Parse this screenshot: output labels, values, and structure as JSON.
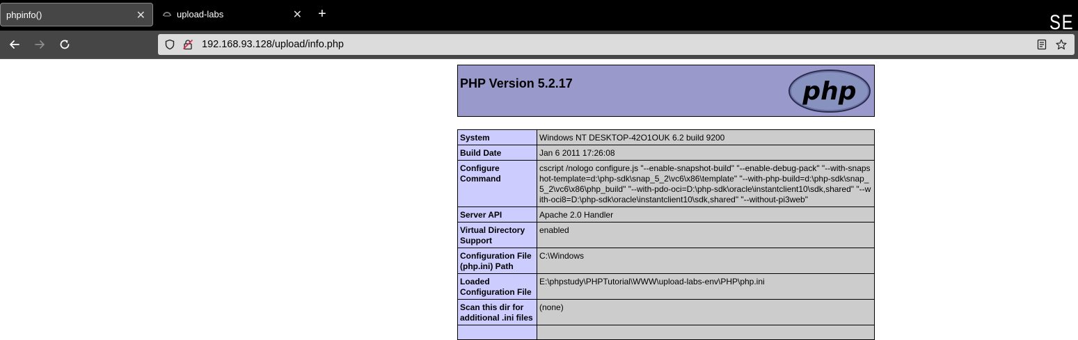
{
  "browser": {
    "tabs": [
      {
        "title": "phpinfo()",
        "active": true
      },
      {
        "title": "upload-labs",
        "active": false
      }
    ],
    "corner_text": "SE",
    "url": "192.168.93.128/upload/info.php"
  },
  "page": {
    "title": "PHP Version 5.2.17",
    "logo_text": "php",
    "rows": [
      {
        "key": "System",
        "value": "Windows NT DESKTOP-42O1OUK 6.2 build 9200"
      },
      {
        "key": "Build Date",
        "value": "Jan 6 2011 17:26:08"
      },
      {
        "key": "Configure Command",
        "value": "cscript /nologo configure.js \"--enable-snapshot-build\" \"--enable-debug-pack\" \"--with-snapshot-template=d:\\php-sdk\\snap_5_2\\vc6\\x86\\template\" \"--with-php-build=d:\\php-sdk\\snap_5_2\\vc6\\x86\\php_build\" \"--with-pdo-oci=D:\\php-sdk\\oracle\\instantclient10\\sdk,shared\" \"--with-oci8=D:\\php-sdk\\oracle\\instantclient10\\sdk,shared\" \"--without-pi3web\""
      },
      {
        "key": "Server API",
        "value": "Apache 2.0 Handler"
      },
      {
        "key": "Virtual Directory Support",
        "value": "enabled"
      },
      {
        "key": "Configuration File (php.ini) Path",
        "value": "C:\\Windows"
      },
      {
        "key": "Loaded Configuration File",
        "value": "E:\\phpstudy\\PHPTutorial\\WWW\\upload-labs-env\\PHP\\php.ini"
      },
      {
        "key": "Scan this dir for additional .ini files",
        "value": "(none)"
      },
      {
        "key": "",
        "value": ""
      }
    ]
  },
  "colors": {
    "header_bg": "#9999cc",
    "key_bg": "#ccccff",
    "value_bg": "#cccccc"
  }
}
